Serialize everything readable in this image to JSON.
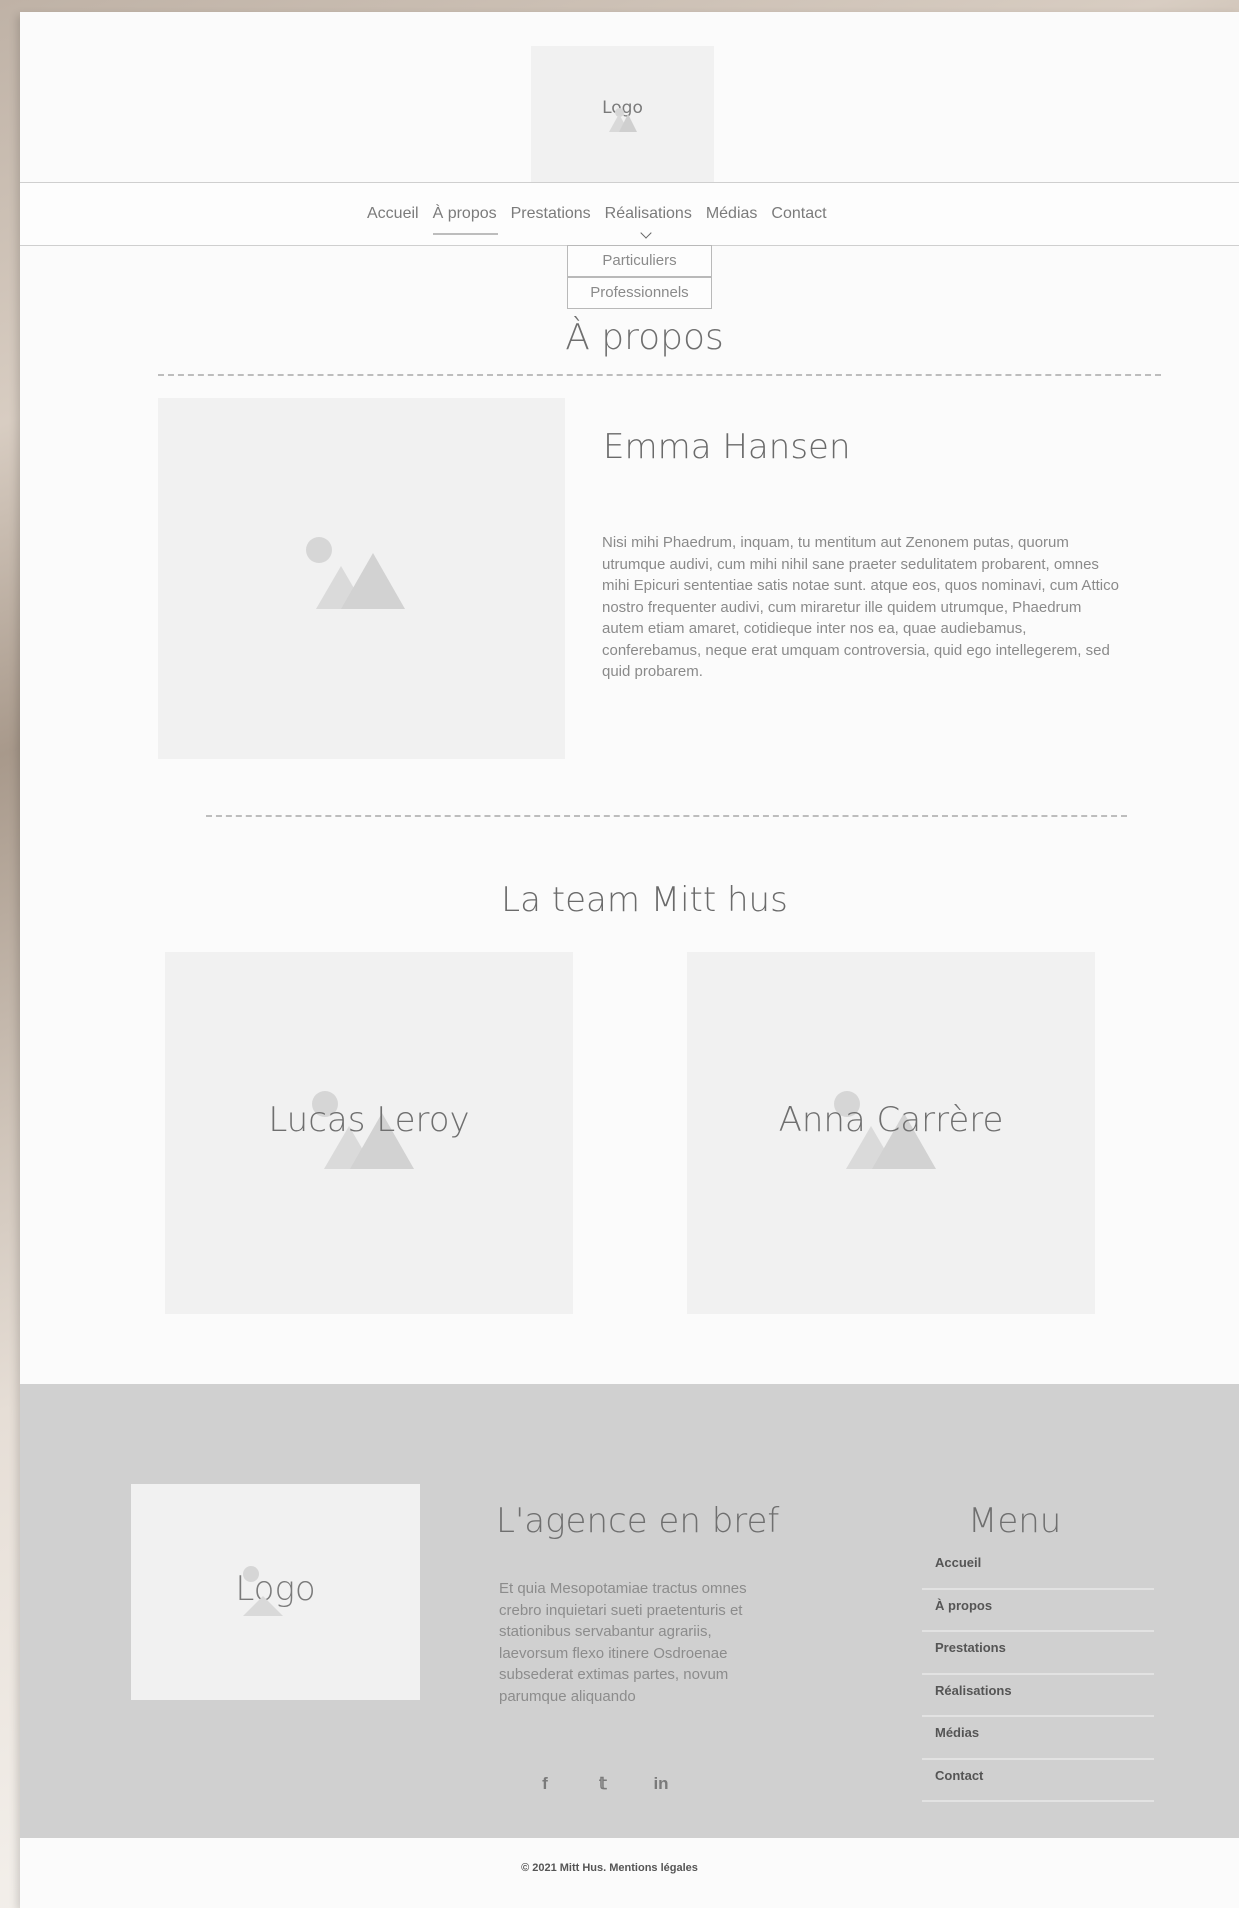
{
  "header": {
    "logo_label": "Logo"
  },
  "nav": {
    "items": [
      {
        "label": "Accueil"
      },
      {
        "label": "À propos"
      },
      {
        "label": "Prestations"
      },
      {
        "label": "Réalisations"
      },
      {
        "label": "Médias"
      },
      {
        "label": "Contact"
      }
    ],
    "active": "À propos",
    "dropdown": [
      "Particuliers",
      "Professionnels"
    ]
  },
  "about": {
    "title": "À propos",
    "person_name": "Emma Hansen",
    "bio": "Nisi mihi Phaedrum, inquam, tu mentitum aut Zenonem putas, quorum utrumque audivi, cum mihi nihil sane praeter sedulitatem probarent, omnes mihi Epicuri sententiae satis notae sunt. atque eos, quos nominavi, cum Attico nostro frequenter audivi, cum miraretur ille quidem utrumque, Phaedrum autem etiam amaret, cotidieque inter nos ea, quae audiebamus, conferebamus, neque erat umquam controversia, quid ego intellegerem, sed quid probarem."
  },
  "team": {
    "title": "La team Mitt hus",
    "members": [
      {
        "name": "Lucas Leroy"
      },
      {
        "name": "Anna Carrère"
      }
    ]
  },
  "footer": {
    "logo_label": "Logo",
    "agence_title": "L'agence en bref",
    "agence_text": "Et quia Mesopotamiae tractus omnes crebro inquietari sueti praetenturis et stationibus servabantur agrariis, laevorsum flexo itinere Osdroenae subsederat extimas partes, novum parumque aliquando",
    "socials": [
      {
        "icon": "facebook-icon",
        "glyph": "f"
      },
      {
        "icon": "twitter-icon",
        "glyph": "𝕥"
      },
      {
        "icon": "linkedin-icon",
        "glyph": "in"
      }
    ],
    "menu_title": "Menu",
    "menu_items": [
      "Accueil",
      "À propos",
      "Prestations",
      "Réalisations",
      "Médias",
      "Contact"
    ],
    "copyright": "© 2021 Mitt Hus. Mentions légales"
  }
}
